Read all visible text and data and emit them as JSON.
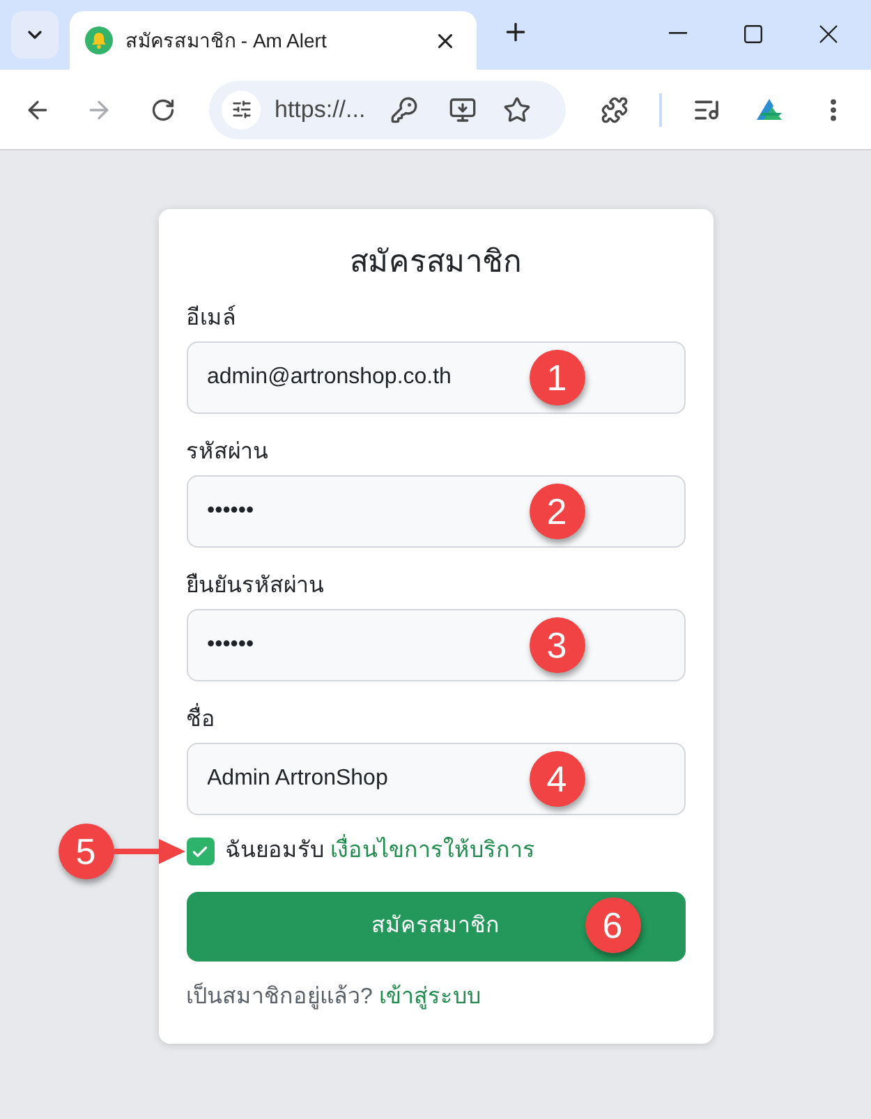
{
  "browser": {
    "tab": {
      "title": "สมัครสมาชิก - Am Alert"
    },
    "forward": {
      "disabled": true
    },
    "address_bar": {
      "url": "https://..."
    }
  },
  "form": {
    "title": "สมัครสมาชิก",
    "fields": [
      {
        "label": "อีเมล์",
        "value": "admin@artronshop.co.th",
        "marker": "1"
      },
      {
        "label": "รหัสผ่าน",
        "value": "••••••",
        "marker": "2"
      },
      {
        "label": "ยืนยันรหัสผ่าน",
        "value": "••••••",
        "marker": "3"
      },
      {
        "label": "ชื่อ",
        "value": "Admin ArtronShop",
        "marker": "4"
      }
    ],
    "terms": {
      "checked": true,
      "text": "ฉันยอมรับ",
      "link": "เงื่อนไขการให้บริการ",
      "marker": "5"
    },
    "submit": {
      "label": "สมัครสมาชิก",
      "marker": "6"
    },
    "footer": {
      "text": "เป็นสมาชิกอยู่แล้ว?",
      "link": "เข้าสู่ระบบ"
    }
  }
}
